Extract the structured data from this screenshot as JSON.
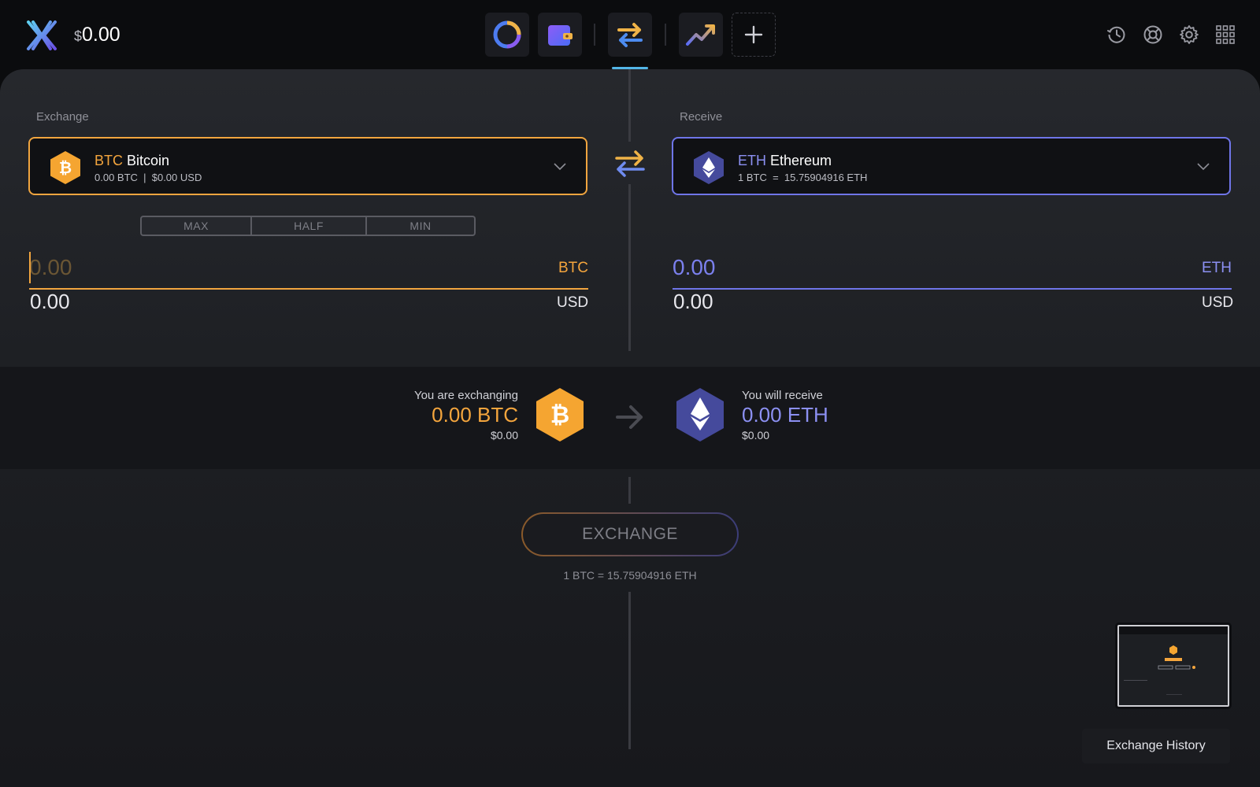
{
  "header": {
    "balance_currency": "$",
    "balance_value": "0.00",
    "nav_icons": [
      "portfolio-icon",
      "wallet-icon",
      "exchange-icon",
      "trade-icon",
      "add-app-icon"
    ],
    "right_icons": [
      "history-icon",
      "help-icon",
      "settings-icon",
      "apps-grid-icon"
    ],
    "accent": "#53b6e8"
  },
  "exchange": {
    "label": "Exchange",
    "ticker": "BTC",
    "name": "Bitcoin",
    "balance_line": "0.00 BTC  |  $0.00 USD",
    "amount_placeholder": "0.00",
    "unit": "BTC",
    "usd_value": "0.00",
    "usd_unit": "USD",
    "color": "#f1a53f"
  },
  "receive": {
    "label": "Receive",
    "ticker": "ETH",
    "name": "Ethereum",
    "rate_line": "1 BTC  =  15.75904916 ETH",
    "amount": "0.00",
    "unit": "ETH",
    "usd_value": "0.00",
    "usd_unit": "USD",
    "color": "#6f75e8"
  },
  "quick_amounts": [
    "MAX",
    "HALF",
    "MIN"
  ],
  "summary": {
    "exchanging_label": "You are exchanging",
    "exchanging_amount": "0.00 BTC",
    "exchanging_usd": "$0.00",
    "receive_label": "You will receive",
    "receive_amount": "0.00 ETH",
    "receive_usd": "$0.00"
  },
  "action": {
    "button_label": "EXCHANGE",
    "rate_text": "1 BTC = 15.75904916 ETH"
  },
  "history_button": "Exchange History"
}
